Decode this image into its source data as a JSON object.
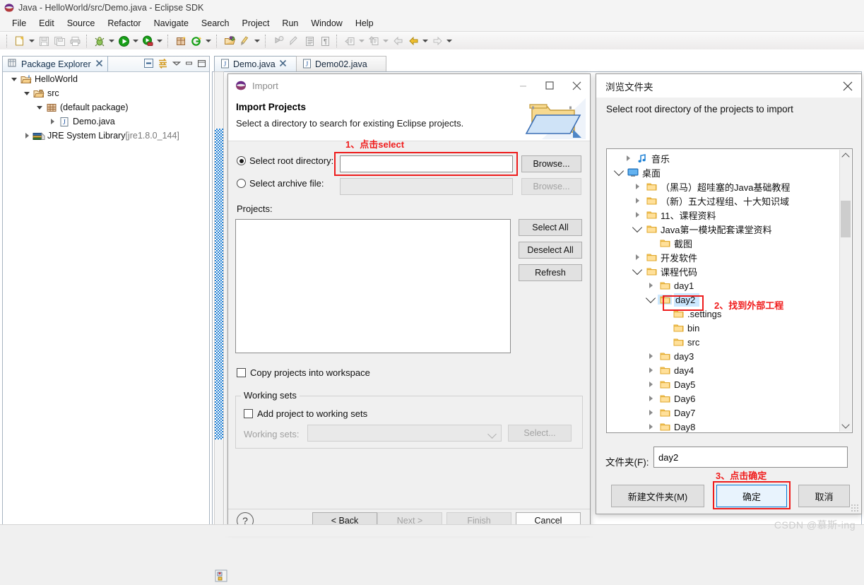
{
  "window": {
    "title": "Java - HelloWorld/src/Demo.java - Eclipse SDK",
    "icon": "eclipse-icon"
  },
  "menubar": {
    "items": [
      {
        "label": "File"
      },
      {
        "label": "Edit"
      },
      {
        "label": "Source"
      },
      {
        "label": "Refactor"
      },
      {
        "label": "Navigate"
      },
      {
        "label": "Search"
      },
      {
        "label": "Project"
      },
      {
        "label": "Run"
      },
      {
        "label": "Window"
      },
      {
        "label": "Help"
      }
    ]
  },
  "toolbar": {
    "buttons": [
      {
        "name": "new-wizard-icon"
      },
      {
        "name": "save-icon"
      },
      {
        "name": "save-all-icon"
      },
      {
        "name": "print-icon"
      },
      {
        "name": "debug-icon"
      },
      {
        "name": "run-icon"
      },
      {
        "name": "external-tools-icon"
      },
      {
        "name": "new-java-package-icon"
      },
      {
        "name": "new-java-class-icon"
      },
      {
        "name": "open-type-icon"
      },
      {
        "name": "search-icon"
      },
      {
        "name": "next-annotation-icon"
      },
      {
        "name": "previous-annotation-icon"
      },
      {
        "name": "toggle-mark-occurrences-icon"
      },
      {
        "name": "show-whitespace-icon"
      },
      {
        "name": "previous-edit-icon"
      },
      {
        "name": "next-edit-icon"
      },
      {
        "name": "back-icon"
      },
      {
        "name": "forward-icon"
      }
    ]
  },
  "package_explorer": {
    "tab_label": "Package Explorer",
    "view_tools": [
      "collapse-all-icon",
      "link-with-editor-icon",
      "view-menu-icon",
      "minimize-icon",
      "maximize-icon"
    ],
    "tree": [
      {
        "label": "HelloWorld",
        "indent": 0,
        "twisty": "down",
        "icon": "java-project-icon"
      },
      {
        "label": "src",
        "indent": 1,
        "twisty": "down",
        "icon": "source-folder-icon"
      },
      {
        "label": "(default package)",
        "indent": 2,
        "twisty": "down",
        "icon": "package-icon"
      },
      {
        "label": "Demo.java",
        "indent": 3,
        "twisty": "right",
        "icon": "java-file-icon"
      },
      {
        "label": "JRE System Library",
        "suffix": " [jre1.8.0_144]",
        "indent": 1,
        "twisty": "right",
        "icon": "library-icon"
      }
    ]
  },
  "editor": {
    "tabs": [
      {
        "label": "Demo.java",
        "icon": "java-file-icon",
        "active": true,
        "closable": true
      },
      {
        "label": "Demo02.java",
        "icon": "java-file-icon",
        "active": false,
        "closable": false
      }
    ]
  },
  "import_dialog": {
    "title": "Import",
    "title_icon": "eclipse-icon",
    "window_buttons": [
      "minimize-icon",
      "maximize-icon",
      "close-icon"
    ],
    "heading": "Import Projects",
    "subheading": "Select a directory to search for existing Eclipse projects.",
    "banner_icon": "import-folder-icon",
    "select_root_directory": {
      "label": "Select root directory:",
      "selected": true,
      "value": "",
      "browse_label": "Browse..."
    },
    "select_archive_file": {
      "label": "Select archive file:",
      "selected": false,
      "value": "",
      "browse_label": "Browse...",
      "enabled": false
    },
    "projects_label": "Projects:",
    "projects_items": [],
    "side_buttons": [
      {
        "label": "Select All",
        "enabled": true
      },
      {
        "label": "Deselect All",
        "enabled": true
      },
      {
        "label": "Refresh",
        "enabled": true
      }
    ],
    "copy_projects_checkbox": {
      "label": "Copy projects into workspace",
      "checked": false
    },
    "working_sets_group": {
      "title": "Working sets",
      "add_checkbox": {
        "label": "Add project to working sets",
        "checked": false
      },
      "working_sets_label": "Working sets:",
      "working_sets_value": "",
      "select_label": "Select...",
      "enabled": false
    },
    "footer": {
      "help_icon": "help-icon",
      "buttons": [
        {
          "label": "< Back",
          "enabled": true
        },
        {
          "label": "Next >",
          "enabled": false
        },
        {
          "label": "Finish",
          "enabled": false
        },
        {
          "label": "Cancel",
          "enabled": true
        }
      ]
    }
  },
  "folder_dialog": {
    "title": "浏览文件夹",
    "close_icon": "close-icon",
    "prompt": "Select root directory of the projects to import",
    "tree": [
      {
        "label": "音乐",
        "indent": 1,
        "twisty": "right",
        "icon": "music-icon",
        "selected": false
      },
      {
        "label": "桌面",
        "indent": 1,
        "twisty": "down",
        "icon": "desktop-icon",
        "selected": false
      },
      {
        "label": "（黑马）超哇塞的Java基础教程",
        "indent": 2,
        "twisty": "right",
        "icon": "folder-icon",
        "selected": false
      },
      {
        "label": "（新）五大过程组、十大知识域",
        "indent": 2,
        "twisty": "right",
        "icon": "folder-icon",
        "selected": false
      },
      {
        "label": "11、课程资料",
        "indent": 2,
        "twisty": "right",
        "icon": "folder-icon",
        "selected": false
      },
      {
        "label": "Java第一模块配套课堂资料",
        "indent": 2,
        "twisty": "down",
        "icon": "folder-icon",
        "selected": false
      },
      {
        "label": "截图",
        "indent": 3,
        "twisty": "none",
        "icon": "folder-icon",
        "selected": false
      },
      {
        "label": "开发软件",
        "indent": 3,
        "twisty": "right",
        "icon": "folder-icon",
        "selected": false
      },
      {
        "label": "课程代码",
        "indent": 3,
        "twisty": "down",
        "icon": "folder-icon",
        "selected": false
      },
      {
        "label": "day1",
        "indent": 4,
        "twisty": "right",
        "icon": "folder-icon",
        "selected": false
      },
      {
        "label": "day2",
        "indent": 4,
        "twisty": "down",
        "icon": "folder-icon",
        "selected": true
      },
      {
        "label": ".settings",
        "indent": 5,
        "twisty": "none",
        "icon": "folder-icon",
        "selected": false
      },
      {
        "label": "bin",
        "indent": 5,
        "twisty": "none",
        "icon": "folder-icon",
        "selected": false
      },
      {
        "label": "src",
        "indent": 5,
        "twisty": "none",
        "icon": "folder-icon",
        "selected": false
      },
      {
        "label": "day3",
        "indent": 4,
        "twisty": "right",
        "icon": "folder-icon",
        "selected": false
      },
      {
        "label": "day4",
        "indent": 4,
        "twisty": "right",
        "icon": "folder-icon",
        "selected": false
      },
      {
        "label": "Day5",
        "indent": 4,
        "twisty": "right",
        "icon": "folder-icon",
        "selected": false
      },
      {
        "label": "Day6",
        "indent": 4,
        "twisty": "right",
        "icon": "folder-icon",
        "selected": false
      },
      {
        "label": "Day7",
        "indent": 4,
        "twisty": "right",
        "icon": "folder-icon",
        "selected": false
      },
      {
        "label": "Day8",
        "indent": 4,
        "twisty": "right",
        "icon": "folder-icon",
        "selected": false
      }
    ],
    "folder_field": {
      "label": "文件夹(F):",
      "value": "day2"
    },
    "buttons": {
      "new_folder": "新建文件夹(M)",
      "ok": "确定",
      "cancel": "取消"
    }
  },
  "annotations": [
    {
      "id": "step1",
      "text": "1、点击select"
    },
    {
      "id": "step2",
      "text": "2、找到外部工程"
    },
    {
      "id": "step3",
      "text": "3、点击确定"
    }
  ],
  "watermark": "CSDN @慕斯-ing",
  "colors": {
    "annotation_red": "#f01c1c",
    "selection_blue": "#cce8ff",
    "accent_blue": "#0078d7",
    "folder_yellow": "#ffd170"
  }
}
